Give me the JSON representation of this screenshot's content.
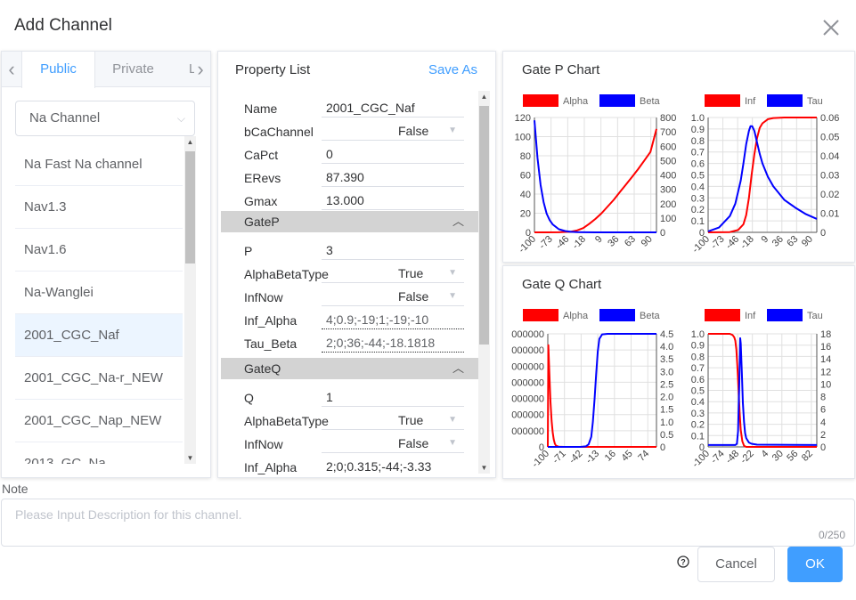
{
  "dialog": {
    "title": "Add Channel"
  },
  "left": {
    "tabs": [
      "Public",
      "Private",
      "L"
    ],
    "select_value": "Na Channel",
    "channels": [
      "Na Fast Na channel",
      "Nav1.3",
      "Nav1.6",
      "Na-Wanglei",
      "2001_CGC_Naf",
      "2001_CGC_Na-r_NEW",
      "2001_CGC_Nap_NEW",
      "2013_GC_Na"
    ],
    "selected_index": 4
  },
  "props": {
    "title": "Property List",
    "save_as": "Save As",
    "name_label": "Name",
    "name_value": "2001_CGC_Naf",
    "bca_label": "bCaChannel",
    "bca_value": "False",
    "capct_label": "CaPct",
    "capct_value": "0",
    "erevs_label": "ERevs",
    "erevs_value": "87.390",
    "gmax_label": "Gmax",
    "gmax_value": "13.000",
    "gatep_section": "GateP",
    "p_label": "P",
    "p_value": "3",
    "p_abt_label": "AlphaBetaType",
    "p_abt_value": "True",
    "p_inf_label": "InfNow",
    "p_inf_value": "False",
    "p_infalpha_label": "Inf_Alpha",
    "p_infalpha_value": "4;0.9;-19;1;-19;-10",
    "p_taubeta_label": "Tau_Beta",
    "p_taubeta_value": "2;0;36;-44;-18.1818",
    "gateq_section": "GateQ",
    "q_label": "Q",
    "q_value": "1",
    "q_abt_label": "AlphaBetaType",
    "q_abt_value": "True",
    "q_inf_label": "InfNow",
    "q_inf_value": "False",
    "q_infalpha_label": "Inf_Alpha",
    "q_infalpha_value": "2;0;0.315;-44;-3.33"
  },
  "charts": {
    "p_title": "Gate P Chart",
    "q_title": "Gate Q Chart"
  },
  "colors": {
    "accent": "#409eff",
    "alpha": "#ff0000",
    "beta": "#0000ff"
  },
  "note": {
    "label": "Note",
    "placeholder": "Please Input Description for this channel.",
    "count": "0/250"
  },
  "buttons": {
    "cancel": "Cancel",
    "ok": "OK"
  },
  "chart_data": [
    {
      "type": "line",
      "title": "",
      "legend": [
        "Alpha",
        "Beta"
      ],
      "legend_position": "top",
      "x_ticks": [
        "-100",
        "-73",
        "-46",
        "-18",
        "9",
        "36",
        "63",
        "90"
      ],
      "y_left_ticks": [
        "0",
        "20",
        "40",
        "60",
        "80",
        "100",
        "120"
      ],
      "ylim_left": [
        0,
        120
      ],
      "y_right_ticks": [
        "0",
        "100",
        "200",
        "300",
        "400",
        "500",
        "600",
        "700",
        "800"
      ],
      "ylim_right": [
        0,
        800
      ],
      "xlim": [
        -100,
        100
      ],
      "series": [
        {
          "name": "Alpha",
          "axis": "left",
          "x": [
            -100,
            -80,
            -60,
            -40,
            -30,
            -20,
            -10,
            0,
            10,
            20,
            30,
            40,
            50,
            60,
            70,
            80,
            90,
            100
          ],
          "y": [
            0,
            0,
            0.1,
            0.7,
            2,
            4.5,
            9,
            14,
            20,
            27,
            34,
            42,
            50,
            58,
            66,
            75,
            84,
            108
          ]
        },
        {
          "name": "Beta",
          "axis": "right",
          "x": [
            -100,
            -95,
            -90,
            -85,
            -80,
            -75,
            -70,
            -60,
            -50,
            -40,
            -30,
            -20,
            0,
            100
          ],
          "y": [
            780,
            520,
            330,
            210,
            130,
            85,
            55,
            22,
            9,
            4,
            1.5,
            0.5,
            0,
            0
          ]
        }
      ]
    },
    {
      "type": "line",
      "title": "",
      "legend": [
        "Inf",
        "Tau"
      ],
      "legend_position": "top",
      "x_ticks": [
        "-100",
        "-73",
        "-46",
        "-18",
        "9",
        "36",
        "63",
        "90"
      ],
      "y_left_ticks": [
        "0",
        "0.1",
        "0.2",
        "0.3",
        "0.4",
        "0.5",
        "0.6",
        "0.7",
        "0.8",
        "0.9",
        "1.0"
      ],
      "ylim_left": [
        0,
        1
      ],
      "y_right_ticks": [
        "0",
        "0.01",
        "0.02",
        "0.03",
        "0.04",
        "0.05",
        "0.06"
      ],
      "ylim_right": [
        0,
        0.06
      ],
      "xlim": [
        -100,
        100
      ],
      "series": [
        {
          "name": "Inf",
          "axis": "left",
          "x": [
            -100,
            -60,
            -45,
            -35,
            -30,
            -25,
            -20,
            -15,
            -10,
            -5,
            0,
            10,
            20,
            40,
            100
          ],
          "y": [
            0,
            0.002,
            0.02,
            0.07,
            0.15,
            0.3,
            0.5,
            0.68,
            0.82,
            0.91,
            0.95,
            0.985,
            0.995,
            1.0,
            1.0
          ]
        },
        {
          "name": "Tau",
          "axis": "right",
          "x": [
            -100,
            -80,
            -60,
            -50,
            -40,
            -35,
            -30,
            -25,
            -22,
            -19,
            -15,
            -10,
            -5,
            0,
            10,
            20,
            40,
            60,
            80,
            100
          ],
          "y": [
            0.0005,
            0.0025,
            0.0085,
            0.015,
            0.027,
            0.036,
            0.046,
            0.053,
            0.0555,
            0.0555,
            0.053,
            0.047,
            0.041,
            0.036,
            0.029,
            0.024,
            0.017,
            0.013,
            0.0095,
            0.007
          ]
        }
      ]
    },
    {
      "type": "line",
      "title": "",
      "legend": [
        "Alpha",
        "Beta"
      ],
      "legend_position": "top",
      "x_ticks": [
        "-100",
        "-71",
        "-42",
        "-13",
        "16",
        "45",
        "74"
      ],
      "y_left_ticks": [
        "0",
        "000000",
        "000000",
        "000000",
        "000000",
        "000000",
        "000000",
        "000000"
      ],
      "ylim_left": [
        0,
        7
      ],
      "y_right_ticks": [
        "0",
        "0.5",
        "1.0",
        "1.5",
        "2.0",
        "2.5",
        "3.0",
        "3.5",
        "4.0",
        "4.5"
      ],
      "ylim_right": [
        0,
        4.5
      ],
      "xlim": [
        -100,
        100
      ],
      "series": [
        {
          "name": "Alpha",
          "axis": "left",
          "x": [
            -100,
            -99,
            -97,
            -95,
            -93,
            -91,
            -89,
            -87,
            -85,
            -80,
            -70,
            100
          ],
          "y": [
            0,
            6.3,
            4.5,
            2.8,
            1.6,
            0.9,
            0.45,
            0.2,
            0.08,
            0.01,
            0,
            0
          ]
        },
        {
          "name": "Beta",
          "axis": "right",
          "x": [
            -100,
            -40,
            -30,
            -25,
            -20,
            -17,
            -14,
            -11,
            -8,
            -5,
            0,
            10,
            100
          ],
          "y": [
            0,
            0,
            0.02,
            0.1,
            0.4,
            1.0,
            1.9,
            2.9,
            3.8,
            4.3,
            4.48,
            4.5,
            4.5
          ]
        }
      ]
    },
    {
      "type": "line",
      "title": "",
      "legend": [
        "Inf",
        "Tau"
      ],
      "legend_position": "top",
      "x_ticks": [
        "-100",
        "-74",
        "-48",
        "-22",
        "4",
        "30",
        "56",
        "82"
      ],
      "y_left_ticks": [
        "0",
        "0.1",
        "0.2",
        "0.3",
        "0.4",
        "0.5",
        "0.6",
        "0.7",
        "0.8",
        "0.9",
        "1.0"
      ],
      "ylim_left": [
        0,
        1
      ],
      "y_right_ticks": [
        "0",
        "2",
        "4",
        "6",
        "8",
        "10",
        "12",
        "14",
        "16",
        "18"
      ],
      "ylim_right": [
        0,
        18
      ],
      "xlim": [
        -100,
        100
      ],
      "series": [
        {
          "name": "Inf",
          "axis": "left",
          "x": [
            -100,
            -60,
            -55,
            -52,
            -50,
            -48,
            -46,
            -44,
            -42,
            -40,
            -37,
            -34,
            -30,
            100
          ],
          "y": [
            1.0,
            1.0,
            0.99,
            0.97,
            0.94,
            0.86,
            0.7,
            0.5,
            0.3,
            0.15,
            0.05,
            0.01,
            0,
            0
          ]
        },
        {
          "name": "Tau",
          "axis": "right",
          "x": [
            -100,
            -50,
            -47,
            -45,
            -43,
            -41,
            -40,
            -38,
            -36,
            -34,
            -32,
            -30,
            -25,
            -20,
            -10,
            100
          ],
          "y": [
            0.3,
            0.3,
            0.5,
            2.5,
            9,
            17.3,
            16.5,
            12,
            7,
            4,
            2.2,
            1.4,
            0.7,
            0.5,
            0.35,
            0.3
          ]
        }
      ]
    }
  ]
}
